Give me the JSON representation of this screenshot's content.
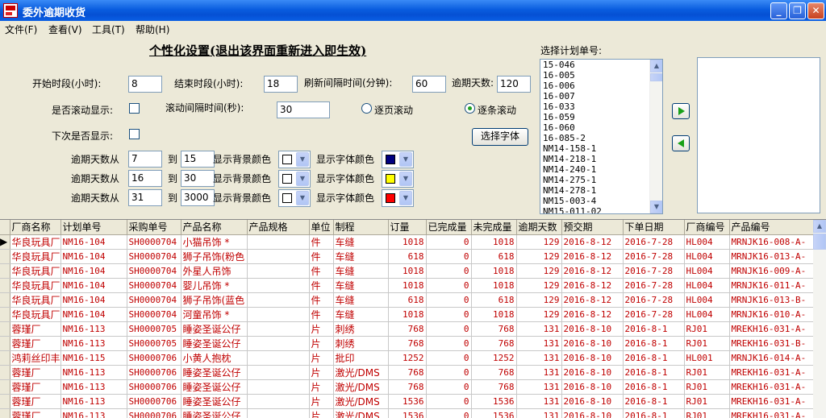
{
  "window": {
    "title": "委外逾期收货"
  },
  "menu": {
    "file": "文件(F)",
    "view": "查看(V)",
    "tools": "工具(T)",
    "help": "帮助(H)"
  },
  "settings": {
    "title": "个性化设置(退出该界面重新进入即生效)",
    "start_label": "开始时段(小时):",
    "start_value": "8",
    "end_label": "结束时段(小时):",
    "end_value": "18",
    "refresh_label": "刷新间隔时间(分钟):",
    "refresh_value": "60",
    "overdue_label": "逾期天数:",
    "overdue_value": "120",
    "scroll_label": "是否滚动显示:",
    "scroll_interval_label": "滚动间隔时间(秒):",
    "scroll_interval_value": "30",
    "page_scroll_label": "逐页滚动",
    "line_scroll_label": "逐条滚动",
    "next_show_label": "下次是否显示:",
    "font_button": "选择字体",
    "range_from_label": "逾期天数从",
    "range_to_label": "到",
    "bg_color_label": "显示背景颜色",
    "font_color_label": "显示字体颜色",
    "ranges": [
      {
        "from": "7",
        "to": "15",
        "bg_color": "#ffffff",
        "font_color": "#000080"
      },
      {
        "from": "16",
        "to": "30",
        "bg_color": "#ffffff",
        "font_color": "#ffff00"
      },
      {
        "from": "31",
        "to": "3000",
        "bg_color": "#ffffff",
        "font_color": "#ff0000"
      }
    ]
  },
  "plan": {
    "label": "选择计划单号:",
    "items": [
      "15-046",
      "16-005",
      "16-006",
      "16-007",
      "16-033",
      "16-059",
      "16-060",
      "16-085-2",
      "NM14-158-1",
      "NM14-218-1",
      "NM14-240-1",
      "NM14-275-1",
      "NM14-278-1",
      "NM15-003-4",
      "NM15-011-02"
    ]
  },
  "table": {
    "headers": [
      "厂商名称",
      "计划单号",
      "采购单号",
      "产品名称",
      "产品规格",
      "单位",
      "制程",
      "订量",
      "已完成量",
      "未完成量",
      "逾期天数",
      "预交期",
      "下单日期",
      "厂商编号",
      "产品编号"
    ],
    "rows": [
      [
        "华良玩具厂",
        "NM16-104",
        "SH0000704",
        "小猫吊饰   *",
        "",
        "件",
        "车缝",
        "1018",
        "0",
        "1018",
        "129",
        "2016-8-12",
        "2016-7-28",
        "HL004",
        "MRNJK16-008-A-"
      ],
      [
        "华良玩具厂",
        "NM16-104",
        "SH0000704",
        "狮子吊饰(粉色",
        "",
        "件",
        "车缝",
        "618",
        "0",
        "618",
        "129",
        "2016-8-12",
        "2016-7-28",
        "HL004",
        "MRNJK16-013-A-"
      ],
      [
        "华良玩具厂",
        "NM16-104",
        "SH0000704",
        "外星人吊饰",
        "",
        "件",
        "车缝",
        "1018",
        "0",
        "1018",
        "129",
        "2016-8-12",
        "2016-7-28",
        "HL004",
        "MRNJK16-009-A-"
      ],
      [
        "华良玩具厂",
        "NM16-104",
        "SH0000704",
        "婴儿吊饰   *",
        "",
        "件",
        "车缝",
        "1018",
        "0",
        "1018",
        "129",
        "2016-8-12",
        "2016-7-28",
        "HL004",
        "MRNJK16-011-A-"
      ],
      [
        "华良玩具厂",
        "NM16-104",
        "SH0000704",
        "狮子吊饰(蓝色",
        "",
        "件",
        "车缝",
        "618",
        "0",
        "618",
        "129",
        "2016-8-12",
        "2016-7-28",
        "HL004",
        "MRNJK16-013-B-"
      ],
      [
        "华良玩具厂",
        "NM16-104",
        "SH0000704",
        "河童吊饰   *",
        "",
        "件",
        "车缝",
        "1018",
        "0",
        "1018",
        "129",
        "2016-8-12",
        "2016-7-28",
        "HL004",
        "MRNJK16-010-A-"
      ],
      [
        "蓉瑾厂",
        "NM16-113",
        "SH0000705",
        "睡姿圣诞公仔",
        "",
        "片",
        "刺绣",
        "768",
        "0",
        "768",
        "131",
        "2016-8-10",
        "2016-8-1",
        "RJ01",
        "MREKH16-031-A-"
      ],
      [
        "蓉瑾厂",
        "NM16-113",
        "SH0000705",
        "睡姿圣诞公仔",
        "",
        "片",
        "刺绣",
        "768",
        "0",
        "768",
        "131",
        "2016-8-10",
        "2016-8-1",
        "RJ01",
        "MREKH16-031-B-"
      ],
      [
        "鸿莉丝印丰",
        "NM16-115",
        "SH0000706",
        "小黄人抱枕",
        "",
        "片",
        "批印",
        "1252",
        "0",
        "1252",
        "131",
        "2016-8-10",
        "2016-8-1",
        "HL001",
        "MRNJK16-014-A-"
      ],
      [
        "蓉瑾厂",
        "NM16-113",
        "SH0000706",
        "睡姿圣诞公仔",
        "",
        "片",
        "激光/DMS",
        "768",
        "0",
        "768",
        "131",
        "2016-8-10",
        "2016-8-1",
        "RJ01",
        "MREKH16-031-A-"
      ],
      [
        "蓉瑾厂",
        "NM16-113",
        "SH0000706",
        "睡姿圣诞公仔",
        "",
        "片",
        "激光/DMS",
        "768",
        "0",
        "768",
        "131",
        "2016-8-10",
        "2016-8-1",
        "RJ01",
        "MREKH16-031-A-"
      ],
      [
        "蓉瑾厂",
        "NM16-113",
        "SH0000706",
        "睡姿圣诞公仔",
        "",
        "片",
        "激光/DMS",
        "1536",
        "0",
        "1536",
        "131",
        "2016-8-10",
        "2016-8-1",
        "RJ01",
        "MREKH16-031-A-"
      ],
      [
        "蓉瑾厂",
        "NM16-113",
        "SH0000706",
        "睡姿圣诞公仔",
        "",
        "片",
        "激光/DMS",
        "1536",
        "0",
        "1536",
        "131",
        "2016-8-10",
        "2016-8-1",
        "RJ01",
        "MREKH16-031-A-"
      ],
      [
        "蓉瑾厂",
        "NM16-113",
        "SH0000706",
        "睡姿圣诞公仔",
        "",
        "片",
        "激光/DMS",
        "768",
        "0",
        "768",
        "131",
        "2016-8-10",
        "2016-8-1",
        "RJ01",
        "MREKH16-031-A-"
      ]
    ]
  }
}
